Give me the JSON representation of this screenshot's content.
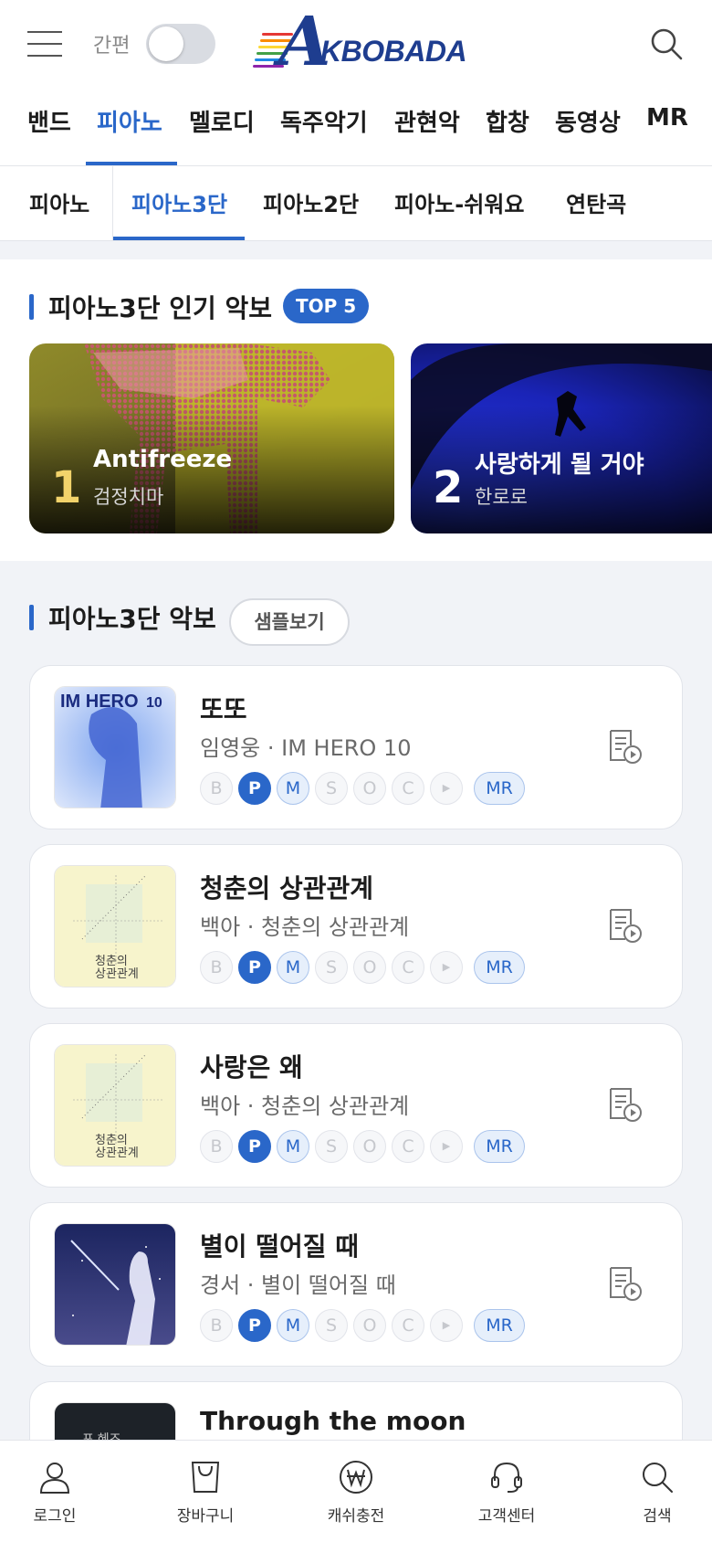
{
  "header": {
    "simple_mode_label": "간편",
    "logo_text": "KBOBADA",
    "logo_colors": [
      "#e53935",
      "#fb8c00",
      "#fdd835",
      "#43a047",
      "#1e88e5",
      "#8e24aa"
    ]
  },
  "main_nav": {
    "items": [
      "밴드",
      "피아노",
      "멜로디",
      "독주악기",
      "관현악",
      "합창",
      "동영상",
      "MR"
    ],
    "active": "피아노"
  },
  "sub_nav": {
    "items": [
      "피아노",
      "피아노3단",
      "피아노2단",
      "피아노-쉬워요",
      "연탄곡"
    ],
    "active": "피아노3단"
  },
  "popular": {
    "title": "피아노3단 인기 악보",
    "badge": "TOP 5",
    "cards": [
      {
        "rank": "1",
        "title": "Antifreeze",
        "artist": "검정치마"
      },
      {
        "rank": "2",
        "title": "사랑하게 될 거야",
        "artist": "한로로"
      }
    ]
  },
  "sheets": {
    "title": "피아노3단 악보",
    "sample_button": "샘플보기",
    "badge_letters": [
      "B",
      "P",
      "M",
      "S",
      "O",
      "C",
      "▶",
      "MR"
    ],
    "items": [
      {
        "title": "또또",
        "artist": "임영웅",
        "album": "IM HERO 10",
        "subtitle": "임영웅 · IM HERO 10"
      },
      {
        "title": "청춘의 상관관계",
        "artist": "백아",
        "album": "청춘의 상관관계",
        "subtitle": "백아 · 청춘의 상관관계"
      },
      {
        "title": "사랑은 왜",
        "artist": "백아",
        "album": "청춘의 상관관계",
        "subtitle": "백아 · 청춘의 상관관계"
      },
      {
        "title": "별이 떨어질 때",
        "artist": "경서",
        "album": "별이 떨어질 때",
        "subtitle": "경서 · 별이 떨어질 때"
      },
      {
        "title": "Through the moon"
      }
    ]
  },
  "thumb_text": {
    "im_hero": "IM HERO",
    "im_hero_num": "10",
    "youth": "청춘의 상관관계",
    "youth_line1": "청춘의",
    "youth_line2": "상관관계",
    "last": "포 헤즈"
  },
  "bottom_nav": {
    "items": [
      "로그인",
      "장바구니",
      "캐쉬충전",
      "고객센터",
      "검색"
    ]
  },
  "colors": {
    "accent": "#2a67c9",
    "rank1": "#f2d36b",
    "rank2": "#ffffff"
  }
}
